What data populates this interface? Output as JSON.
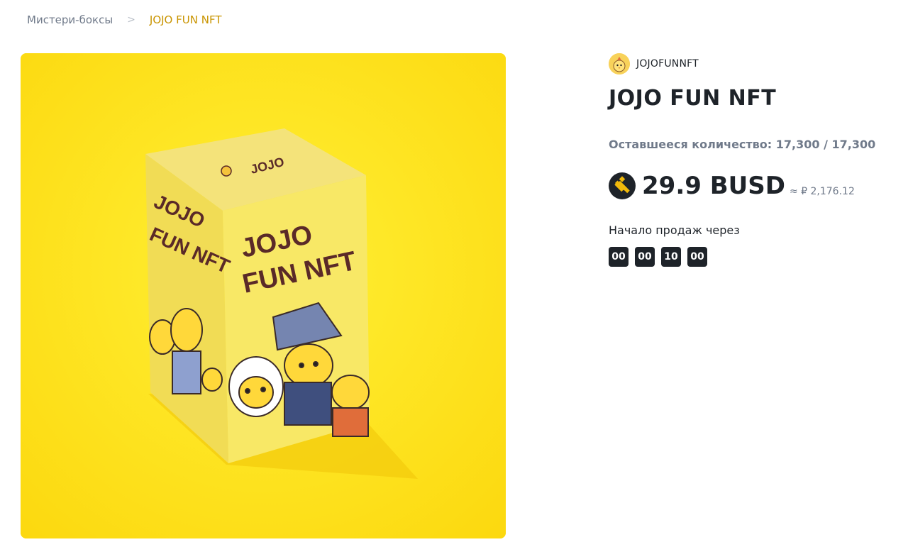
{
  "breadcrumb": {
    "root": "Мистери-боксы",
    "separator": ">",
    "current": "JOJO FUN NFT"
  },
  "hero": {
    "box_brand": "JOJO",
    "box_side_title": "JOJO FUN NFT",
    "box_front_line1": "JOJO",
    "box_front_line2": "FUN NFT",
    "background_color": "#fde21c"
  },
  "product": {
    "creator_name": "JOJOFUNNFT",
    "title": "JOJO FUN NFT",
    "remaining_label": "Оставшееся количество:",
    "remaining_value": "17,300 / 17,300",
    "price": "29.9 BUSD",
    "fiat_equivalent": "≈ ₽ 2,176.12",
    "coin_icon": "busd-coin-icon",
    "sale_start_label": "Начало продаж через",
    "countdown": [
      "00",
      "00",
      "10",
      "00"
    ]
  },
  "colors": {
    "accent": "#c99400",
    "text_primary": "#1e2329",
    "text_secondary": "#707a8a",
    "countdown_bg": "#1e2329"
  }
}
